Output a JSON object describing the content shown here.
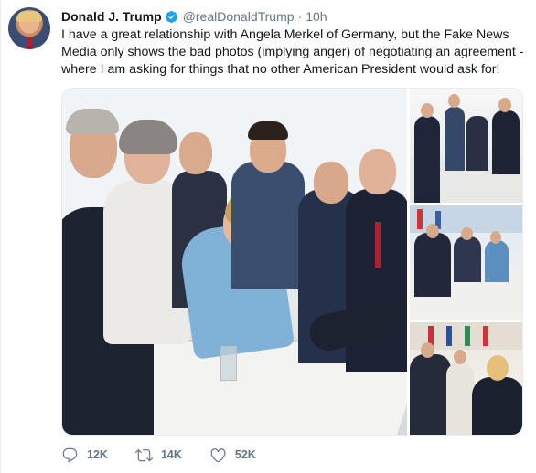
{
  "tweet": {
    "author_name": "Donald J. Trump",
    "handle": "@realDonaldTrump",
    "separator": "·",
    "time": "10h",
    "text": "I have a great relationship with Angela Merkel of Germany, but the Fake News Media only shows the bad photos (implying anger) of negotiating an agreement - where I am asking for things that no other American President would ask for!",
    "verified": true,
    "verified_color": "#1da1f2"
  },
  "actions": {
    "replies": "12K",
    "retweets": "14K",
    "likes": "52K",
    "reply_icon": "reply-icon",
    "retweet_icon": "retweet-icon",
    "like_icon": "heart-icon"
  },
  "media": {
    "photo_count": 4
  }
}
